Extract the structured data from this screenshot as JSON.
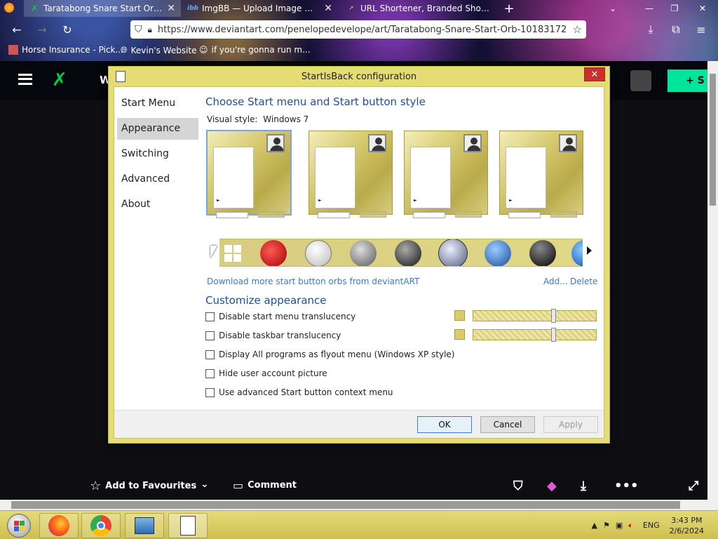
{
  "browser": {
    "tabs": [
      {
        "title": "Taratabong Snare Start Orb by P..."
      },
      {
        "title": "ImgBB — Upload Image — Fre..."
      },
      {
        "title": "URL Shortener, Branded Short..."
      }
    ],
    "new_tab_label": "+",
    "url": "https://www.deviantart.com/penelopedevelope/art/Taratabong-Snare-Start-Orb-10183172",
    "bookmarks": [
      {
        "label": "Horse Insurance - Pick..."
      },
      {
        "label": "Kevin's Website"
      },
      {
        "label": "if you're gonna run m..."
      }
    ]
  },
  "deviantart": {
    "header_partial": "W",
    "submit_partial": "+ S",
    "footer": {
      "add_favourites": "Add to Favourites",
      "comment": "Comment"
    }
  },
  "dialog": {
    "title": "StartIsBack configuration",
    "close": "✕",
    "sidebar": [
      {
        "label": "Start Menu",
        "active": false
      },
      {
        "label": "Appearance",
        "active": true
      },
      {
        "label": "Switching",
        "active": false
      },
      {
        "label": "Advanced",
        "active": false
      },
      {
        "label": "About",
        "active": false
      }
    ],
    "section_style_title": "Choose Start menu and Start button style",
    "visual_style_label": "Visual style:",
    "visual_style_value": "Windows 7",
    "download_link": "Download more start button orbs from deviantART",
    "add_link": "Add...",
    "delete_link": "Delete",
    "customize_title": "Customize appearance",
    "checkboxes": [
      {
        "label": "Disable start menu translucency",
        "checked": false
      },
      {
        "label": "Disable taskbar translucency",
        "checked": false
      },
      {
        "label": "Display All programs as flyout menu (Windows XP style)",
        "checked": false
      },
      {
        "label": "Hide user account picture",
        "checked": false
      },
      {
        "label": "Use advanced Start button context menu",
        "checked": false
      }
    ],
    "sliders": [
      {
        "value_fraction": 0.66
      },
      {
        "value_fraction": 0.66
      }
    ],
    "buttons": {
      "ok": "OK",
      "cancel": "Cancel",
      "apply": "Apply"
    }
  },
  "taskbar": {
    "language": "ENG",
    "time": "3:43 PM",
    "date": "2/6/2024"
  },
  "colors": {
    "dialog_frame": "#e6dc74",
    "accent_blue": "#1f4e9a",
    "link": "#3b7bc8",
    "close_red": "#c9302c"
  }
}
